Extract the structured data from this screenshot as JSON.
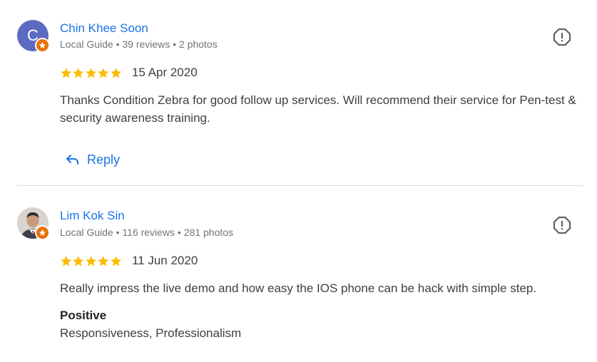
{
  "reviews": [
    {
      "avatar_letter": "C",
      "avatar_color": "#5c6bc0",
      "name": "Chin Khee Soon",
      "meta": "Local Guide • 39 reviews • 2 photos",
      "rating": 5,
      "date": "15 Apr 2020",
      "text": "Thanks Condition Zebra for good follow up services. Will recommend their service for Pen-test & security awareness training.",
      "reply_label": "Reply"
    },
    {
      "avatar_icon": "user-photo",
      "name": "Lim Kok Sin",
      "meta": "Local Guide • 116 reviews • 281 photos",
      "rating": 5,
      "date": "11 Jun 2020",
      "text": "Really impress the live demo and how easy the IOS phone can be hack with simple step.",
      "highlight_title": "Positive",
      "highlight_value": "Responsiveness, Professionalism"
    }
  ],
  "colors": {
    "link": "#1a73e8",
    "star": "#fbbc04",
    "local_guide_badge": "#e8710a",
    "divider": "#dadce0"
  },
  "icons": {
    "report": "report-icon",
    "reply": "reply-arrow-icon",
    "star": "star-icon",
    "badge": "local-guide-badge-icon"
  }
}
